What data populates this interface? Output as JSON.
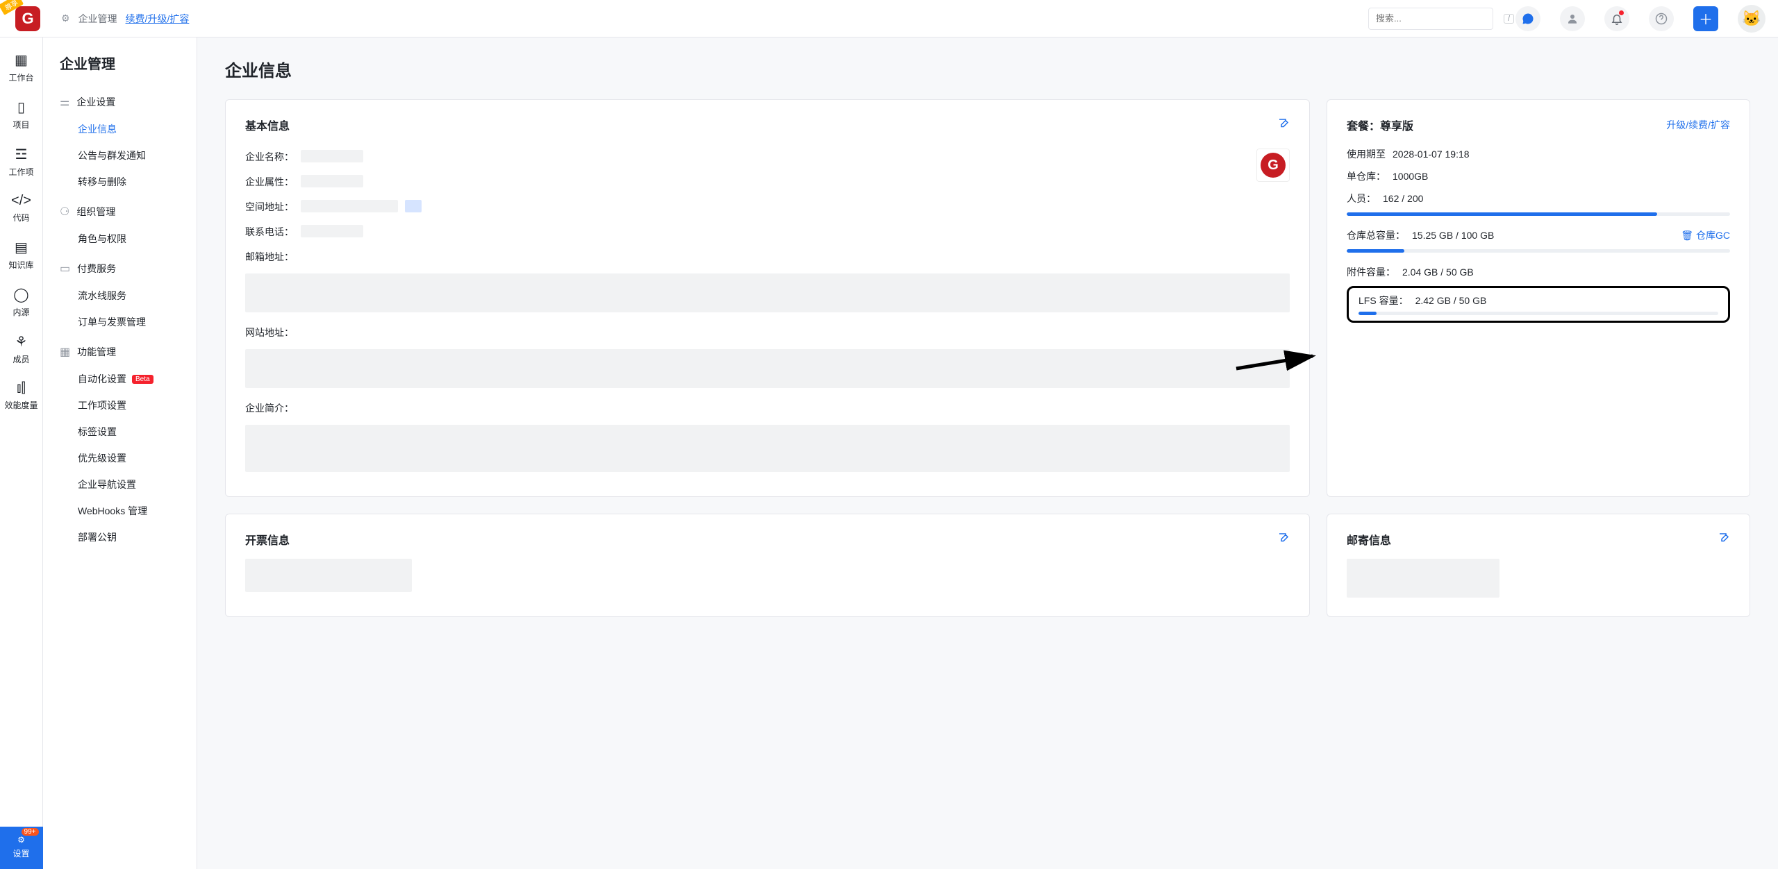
{
  "header": {
    "logo_badge": "尊享",
    "logo_letter": "G",
    "breadcrumb_root": "企业管理",
    "breadcrumb_link": "续费/升级/扩容",
    "search_placeholder": "搜索...",
    "search_shortcut": "/"
  },
  "rail": {
    "workspace": "工作台",
    "project": "项目",
    "workitem": "工作项",
    "code": "代码",
    "wiki": "知识库",
    "internal": "内源",
    "member": "成员",
    "metrics": "效能度量",
    "settings": "设置",
    "settings_badge": "99+"
  },
  "sidebar": {
    "title": "企业管理",
    "g1": {
      "header": "企业设置",
      "a": "企业信息",
      "b": "公告与群发通知",
      "c": "转移与删除"
    },
    "g2": {
      "header": "组织管理",
      "a": "角色与权限"
    },
    "g3": {
      "header": "付费服务",
      "a": "流水线服务",
      "b": "订单与发票管理"
    },
    "g4": {
      "header": "功能管理",
      "a": "自动化设置",
      "a_tag": "Beta",
      "b": "工作项设置",
      "c": "标签设置",
      "d": "优先级设置",
      "e": "企业导航设置",
      "f": "WebHooks 管理",
      "g": "部署公钥"
    }
  },
  "main": {
    "page_title": "企业信息",
    "basic_title": "基本信息",
    "fields": {
      "name": "企业名称：",
      "attr": "企业属性：",
      "space": "空间地址：",
      "phone": "联系电话：",
      "email": "邮箱地址：",
      "website": "网站地址：",
      "desc": "企业简介："
    },
    "invoice_title": "开票信息",
    "mail_title": "邮寄信息"
  },
  "plan": {
    "title_prefix": "套餐：",
    "title_name": "尊享版",
    "upgrade": "升级/续费/扩容",
    "expire_label": "使用期至",
    "expire_value": "2028-01-07 19:18",
    "repo_label": "单仓库：",
    "repo_value": "1000GB",
    "people_label": "人员：",
    "people_value": "162 / 200",
    "people_pct": 81,
    "total_label": "仓库总容量：",
    "total_value": "15.25 GB / 100 GB",
    "total_pct": 15,
    "gc_link": "仓库GC",
    "attach_label": "附件容量：",
    "attach_value": "2.04 GB / 50 GB",
    "attach_pct": 4,
    "lfs_label": "LFS 容量：",
    "lfs_value": "2.42 GB / 50 GB",
    "lfs_pct": 5
  }
}
